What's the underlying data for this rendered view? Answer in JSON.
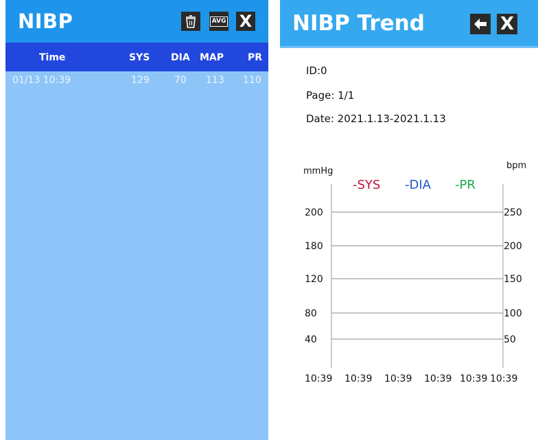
{
  "nibp": {
    "title": "NIBP",
    "buttons": {
      "avg_label": "AVG",
      "close_label": "X"
    },
    "columns": [
      "Time",
      "SYS",
      "DIA",
      "MAP",
      "PR"
    ],
    "rows": [
      {
        "time": "01/13 10:39",
        "sys": "129",
        "dia": "70",
        "map": "113",
        "pr": "110"
      }
    ]
  },
  "trend": {
    "title": "NIBP Trend",
    "close_label": "X",
    "id_text": "ID:0",
    "page_text": "Page:  1/1",
    "date_text": "Date:  2021.1.13-2021.1.13"
  },
  "chart_data": {
    "type": "line",
    "left_unit": "mmHg",
    "right_unit": "bpm",
    "legend": [
      {
        "label": "-SYS",
        "color": "#c0143c"
      },
      {
        "label": "-DIA",
        "color": "#2255c8"
      },
      {
        "label": "-PR",
        "color": "#1aa84a"
      }
    ],
    "left_ticks": [
      "200",
      "180",
      "120",
      "80",
      "40"
    ],
    "right_ticks": [
      "250",
      "200",
      "150",
      "100",
      "50"
    ],
    "x_labels": [
      "10:39",
      "10:39",
      "10:39",
      "10:39",
      "10:39",
      "10:39"
    ],
    "grid": true,
    "series": [
      {
        "name": "-SYS",
        "values": []
      },
      {
        "name": "-DIA",
        "values": []
      },
      {
        "name": "-PR",
        "values": []
      }
    ]
  },
  "colors": {
    "left_header": "#1e95ea",
    "left_body": "#8ec5f8",
    "left_columns_bar": "#2147de",
    "right_header": "#36a8f0"
  },
  "icons": [
    "trash-icon",
    "avg-icon",
    "close-icon",
    "back-arrow-icon"
  ]
}
